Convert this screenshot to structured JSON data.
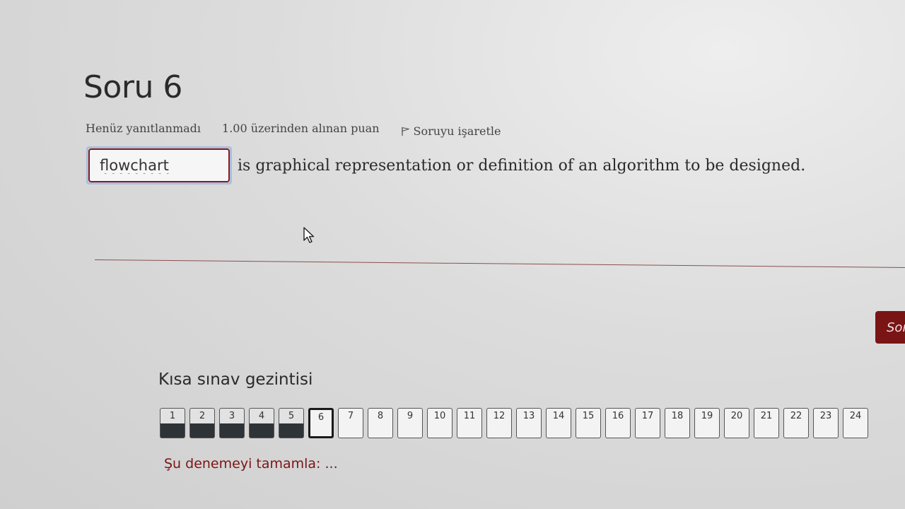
{
  "question": {
    "title": "Soru 6",
    "status": "Henüz yanıtlanmadı",
    "points": "1.00 üzerinden alınan puan",
    "flag_label": "Soruyu işaretle",
    "answer_value": "flowchart",
    "text": "is graphical representation or definition of an algorithm to be designed."
  },
  "next_button": {
    "label": "Sor"
  },
  "navigation": {
    "title": "Kısa sınav gezintisi",
    "current": 6,
    "items": [
      {
        "label": "1",
        "state": "answered"
      },
      {
        "label": "2",
        "state": "answered"
      },
      {
        "label": "3",
        "state": "answered"
      },
      {
        "label": "4",
        "state": "answered"
      },
      {
        "label": "5",
        "state": "answered"
      },
      {
        "label": "6",
        "state": "current"
      },
      {
        "label": "7",
        "state": "unanswered"
      },
      {
        "label": "8",
        "state": "unanswered"
      },
      {
        "label": "9",
        "state": "unanswered"
      },
      {
        "label": "10",
        "state": "unanswered"
      },
      {
        "label": "11",
        "state": "unanswered"
      },
      {
        "label": "12",
        "state": "unanswered"
      },
      {
        "label": "13",
        "state": "unanswered"
      },
      {
        "label": "14",
        "state": "unanswered"
      },
      {
        "label": "15",
        "state": "unanswered"
      },
      {
        "label": "16",
        "state": "unanswered"
      },
      {
        "label": "17",
        "state": "unanswered"
      },
      {
        "label": "18",
        "state": "unanswered"
      },
      {
        "label": "19",
        "state": "unanswered"
      },
      {
        "label": "20",
        "state": "unanswered"
      },
      {
        "label": "21",
        "state": "unanswered"
      },
      {
        "label": "22",
        "state": "unanswered"
      },
      {
        "label": "23",
        "state": "unanswered"
      },
      {
        "label": "24",
        "state": "unanswered"
      }
    ],
    "finish_label": "Şu denemeyi tamamla: ..."
  },
  "colors": {
    "accent": "#7a1515",
    "answered_fill": "#2e3338"
  },
  "icons": {
    "flag": "flag-icon",
    "cursor": "mouse-pointer-icon"
  }
}
